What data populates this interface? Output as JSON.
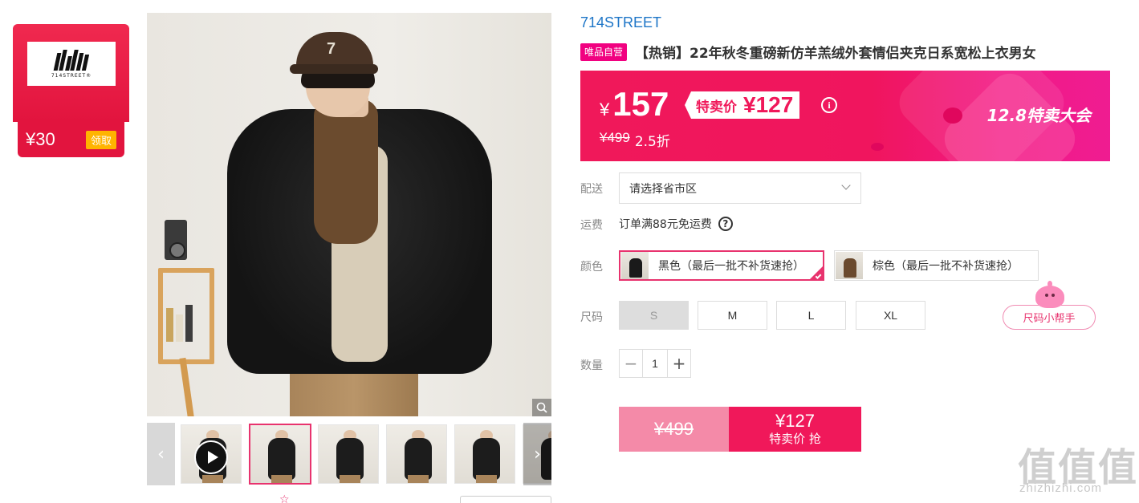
{
  "coupon": {
    "brand_logo_text": "714STREET®",
    "amount": "¥30",
    "claim_label": "领取"
  },
  "gallery": {
    "thumbnail_count": 6,
    "active_index": 1,
    "first_is_video": true
  },
  "product": {
    "brand": "714STREET",
    "self_operated_tag": "唯品自营",
    "title": "【热销】22年秋冬重磅新仿羊羔绒外套情侣夹克日系宽松上衣男女"
  },
  "price": {
    "current_yen": "¥",
    "current": "157",
    "sale_label": "特卖价",
    "sale_price": "¥127",
    "original": "¥499",
    "discount": "2.5折",
    "event_name": "12.8特卖大会"
  },
  "attributes": {
    "delivery_label": "配送",
    "delivery_placeholder": "请选择省市区",
    "shipping_label": "运费",
    "shipping_text": "订单满88元免运费",
    "color_label": "颜色",
    "colors": [
      {
        "label": "黑色（最后一批不补货速抢）",
        "swatch": "#1a1a1a",
        "selected": true
      },
      {
        "label": "棕色（最后一批不补货速抢）",
        "swatch": "#6b4a2e",
        "selected": false
      }
    ],
    "size_label": "尺码",
    "sizes": [
      {
        "label": "S",
        "disabled": true
      },
      {
        "label": "M",
        "disabled": false
      },
      {
        "label": "L",
        "disabled": false
      },
      {
        "label": "XL",
        "disabled": false
      }
    ],
    "size_helper": "尺码小帮手",
    "quantity_label": "数量",
    "quantity": "1"
  },
  "buy": {
    "original": "¥499",
    "price": "¥127",
    "label": "特卖价 抢"
  },
  "watermark": {
    "text": "值值值",
    "url": "zhizhizhi.com"
  },
  "colors": {
    "accent": "#f0185a",
    "brand_link": "#1d75c7",
    "selected_border": "#e8336e"
  }
}
